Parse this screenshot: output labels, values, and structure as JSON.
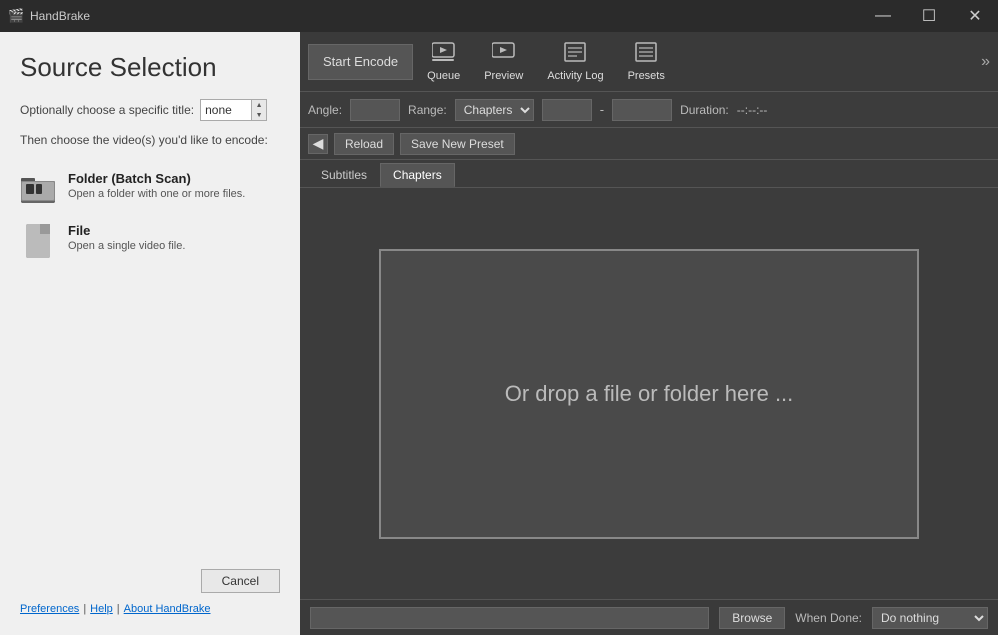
{
  "app": {
    "title": "HandBrake",
    "icon": "🎬"
  },
  "titlebar": {
    "minimize": "—",
    "maximize": "☐",
    "close": "✕"
  },
  "source_panel": {
    "title": "Source Selection",
    "subtitle_choose": "Optionally choose a specific title:",
    "title_value": "none",
    "subtitle_encode": "Then choose the video(s) you'd like to encode:",
    "folder_item": {
      "title": "Folder (Batch Scan)",
      "desc": "Open a folder with one or more files."
    },
    "file_item": {
      "title": "File",
      "desc": "Open a single video file."
    },
    "cancel_label": "Cancel",
    "links": {
      "preferences": "Preferences",
      "separator1": "|",
      "help": "Help",
      "separator2": "|",
      "about": "About HandBrake"
    }
  },
  "toolbar": {
    "start_encode": "Start Encode",
    "queue_label": "Queue",
    "preview_label": "Preview",
    "activity_log_label": "Activity Log",
    "presets_label": "Presets"
  },
  "settings": {
    "angle_label": "Angle:",
    "range_label": "Range:",
    "chapters_value": "Chapters",
    "duration_label": "Duration:",
    "duration_value": "--:--:--"
  },
  "preset_bar": {
    "reload_label": "Reload",
    "save_preset_label": "Save New Preset"
  },
  "tabs": {
    "items": [
      "Subtitles",
      "Chapters"
    ]
  },
  "drop_zone": {
    "text": "Or drop a file or folder here ..."
  },
  "bottom_bar": {
    "browse_label": "Browse",
    "when_done_label": "When Done:",
    "when_done_value": "Do nothing"
  }
}
